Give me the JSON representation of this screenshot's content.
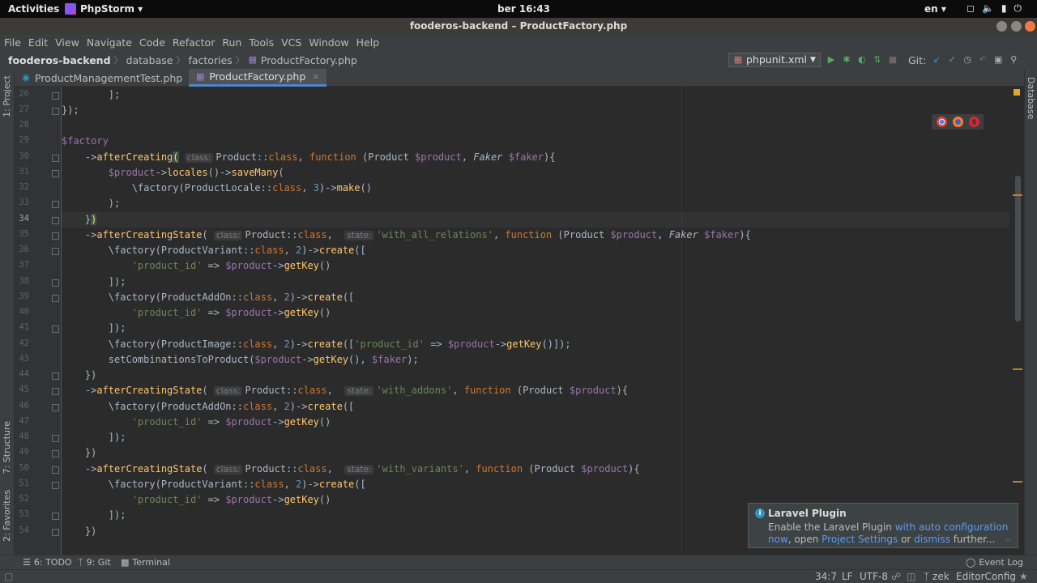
{
  "topbar": {
    "activities": "Activities",
    "app_name": "PhpStorm ▾",
    "clock": "ber 16:43",
    "lang": "en ▾",
    "tray": [
      "wifi-icon",
      "volume-icon",
      "battery-icon",
      "power-icon"
    ]
  },
  "window": {
    "title": "fooderos-backend – ProductFactory.php"
  },
  "menu": [
    "File",
    "Edit",
    "View",
    "Navigate",
    "Code",
    "Refactor",
    "Run",
    "Tools",
    "VCS",
    "Window",
    "Help"
  ],
  "breadcrumb": {
    "root": "fooderos-backend",
    "items": [
      "database",
      "factories"
    ],
    "file": "ProductFactory.php"
  },
  "runconfig": {
    "label": "phpunit.xml",
    "git_label": "Git:"
  },
  "tabs": [
    {
      "label": "ProductManagementTest.php",
      "active": false
    },
    {
      "label": "ProductFactory.php",
      "active": true
    }
  ],
  "left_tools": {
    "project": "1: Project",
    "structure": "7: Structure",
    "favorites": "2: Favorites"
  },
  "right_tools": {
    "database": "Database"
  },
  "editor": {
    "line_numbers": [
      "26",
      "27",
      "28",
      "29",
      "30",
      "31",
      "32",
      "33",
      "34",
      "35",
      "36",
      "37",
      "38",
      "39",
      "40",
      "41",
      "42",
      "43",
      "44",
      "45",
      "46",
      "47",
      "48",
      "49",
      "50",
      "51",
      "52",
      "53",
      "54"
    ],
    "cursor_line": "34"
  },
  "notification": {
    "title": "Laravel Plugin",
    "text_1": "Enable the Laravel Plugin ",
    "link_1": "with auto configuration",
    "link_1b": "now",
    "text_2": ", open ",
    "link_2": "Project Settings",
    "text_3": " or ",
    "link_3": "dismiss",
    "text_4": " further..."
  },
  "bottom_tools": {
    "todo": "6: TODO",
    "git": "9: Git",
    "terminal": "Terminal",
    "event_log": "Event Log"
  },
  "status": {
    "position": "34:7",
    "line_sep": "LF",
    "encoding": "UTF-8",
    "branch": "zek",
    "editorconfig": "EditorConfig"
  }
}
